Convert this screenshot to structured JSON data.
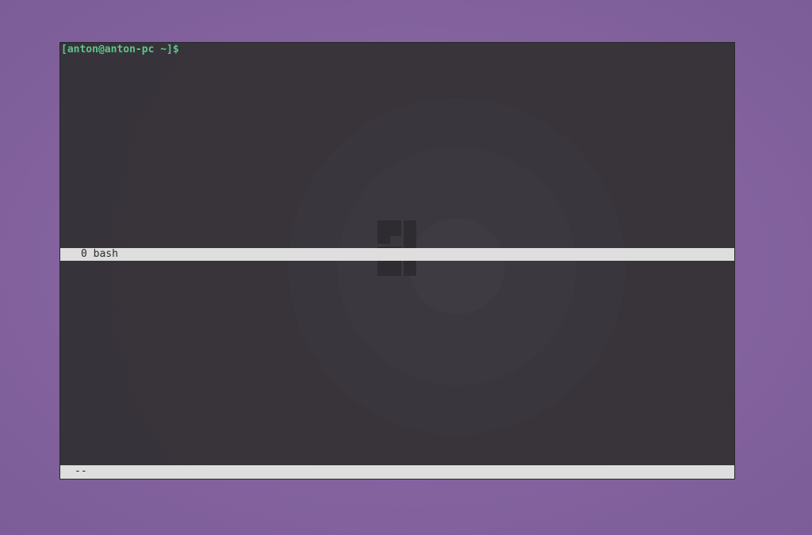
{
  "terminal": {
    "prompt": "[anton@anton-pc ~]$",
    "window_list": "0 bash",
    "bottom_status": "--"
  },
  "colors": {
    "desktop_background": "#8664a1",
    "terminal_background": "#37333a",
    "prompt_color": "#5ec48a",
    "status_bar_background": "#dedede"
  },
  "icons": {
    "watermark": "manjaro-logo-icon"
  }
}
